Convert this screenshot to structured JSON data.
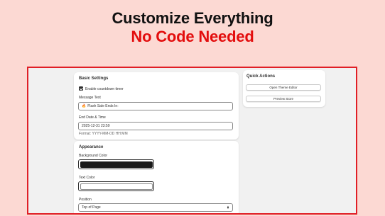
{
  "headline": {
    "line1": "Customize Everything",
    "line2": "No Code Needed"
  },
  "colors": {
    "background": "#fcd9d3",
    "headline_dark": "#111111",
    "headline_red": "#e30d0d",
    "frame_border": "#e01f26",
    "background_color_value": "#1a1a1a",
    "text_color_value": "#ffffff"
  },
  "basic_settings": {
    "title": "Basic Settings",
    "enable_timer": {
      "label": "Enable countdown timer",
      "checked": true
    },
    "message": {
      "label": "Message Text",
      "icon": "fire-icon",
      "value": "Flash Sale Ends In:"
    },
    "end_date": {
      "label": "End Date & Time",
      "value": "2025-12-31 23:59",
      "help": "Format: YYYY-MM-DD HH:MM"
    }
  },
  "appearance": {
    "title": "Appearance",
    "background_color": {
      "label": "Background Color"
    },
    "text_color": {
      "label": "Text Color"
    },
    "position": {
      "label": "Position",
      "value": "Top of Page",
      "icon": "select-arrows-icon"
    }
  },
  "quick_actions": {
    "title": "Quick Actions",
    "open_theme_editor": "Open Theme Editor",
    "preview_store": "Preview Store"
  }
}
